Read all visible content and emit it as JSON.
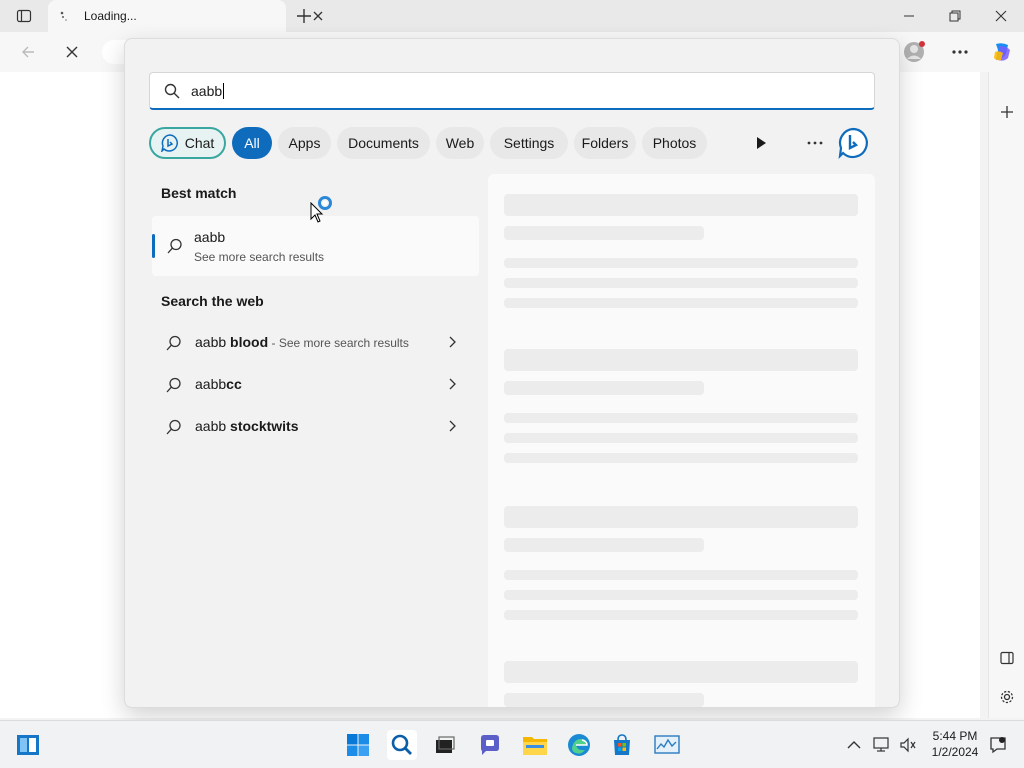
{
  "browser": {
    "tab_title": "Loading...",
    "colors": {
      "accent": "#0f6cbd",
      "chat_border": "#3aa6a0"
    }
  },
  "search": {
    "query": "aabb",
    "filters": {
      "chat": "Chat",
      "all": "All",
      "apps": "Apps",
      "documents": "Documents",
      "web": "Web",
      "settings": "Settings",
      "folders": "Folders",
      "photos": "Photos"
    },
    "best_match": {
      "heading": "Best match",
      "title": "aabb",
      "subtitle": "See more search results"
    },
    "web_section": {
      "heading": "Search the web",
      "results": [
        {
          "prefix": "aabb ",
          "bold": "blood",
          "suffix": " - See more search results"
        },
        {
          "prefix": "aabb",
          "bold": "cc",
          "suffix": ""
        },
        {
          "prefix": "aabb ",
          "bold": "stocktwits",
          "suffix": ""
        }
      ]
    }
  },
  "taskbar": {
    "time": "5:44 PM",
    "date": "1/2/2024",
    "icons": [
      "widgets-icon",
      "start-icon",
      "search-icon",
      "task-view-icon",
      "teams-chat-icon",
      "file-explorer-icon",
      "edge-icon",
      "store-icon",
      "task-manager-icon",
      "chevron-up-icon",
      "network-icon",
      "volume-icon",
      "notification-icon"
    ]
  }
}
